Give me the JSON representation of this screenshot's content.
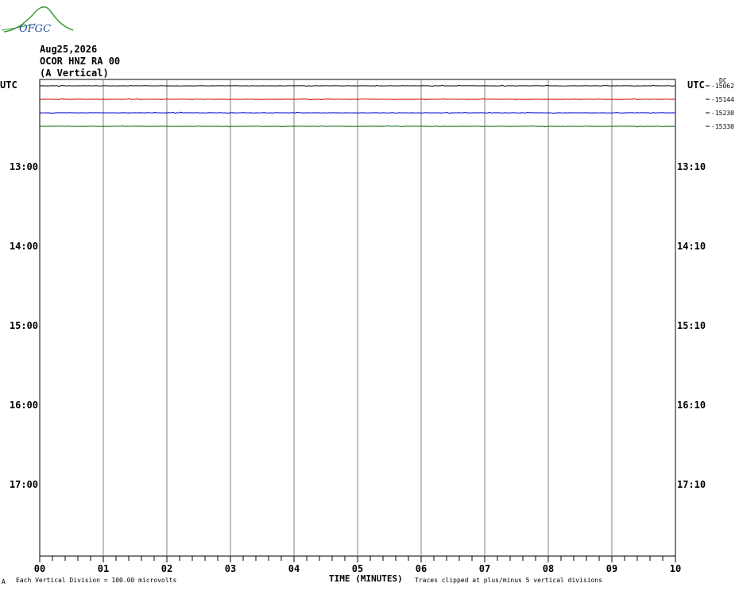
{
  "header": {
    "logo_text": "OFGC",
    "date": "Aug25,2026",
    "station": "OCOR HNZ RA 00",
    "component": "(A Vertical)"
  },
  "axis": {
    "left_utc": "UTC",
    "right_utc": "UTC",
    "dc_label": "DC",
    "xlabel": "TIME (MINUTES)",
    "scale_note": "Each Vertical Division =  100.00 microvolts",
    "clip_note": "Traces clipped at plus/minus 5 vertical divisions",
    "corner_mark": "A"
  },
  "chart_data": {
    "type": "line",
    "x_ticks": [
      "00",
      "01",
      "02",
      "03",
      "04",
      "05",
      "06",
      "07",
      "08",
      "09",
      "10"
    ],
    "xlim": [
      0,
      10
    ],
    "row_labels_left": [
      "13:00",
      "14:00",
      "15:00",
      "16:00",
      "17:00"
    ],
    "row_labels_right": [
      "13:10",
      "14:10",
      "15:10",
      "16:10",
      "17:10"
    ],
    "grid": true,
    "series": [
      {
        "dc": "-15062",
        "color": "#000000",
        "row": 0
      },
      {
        "dc": "-15144",
        "color": "#cc0000",
        "row": 1
      },
      {
        "dc": "-15230",
        "color": "#0000cc",
        "row": 2
      },
      {
        "dc": "-15330",
        "color": "#006600",
        "row": 3
      }
    ]
  }
}
